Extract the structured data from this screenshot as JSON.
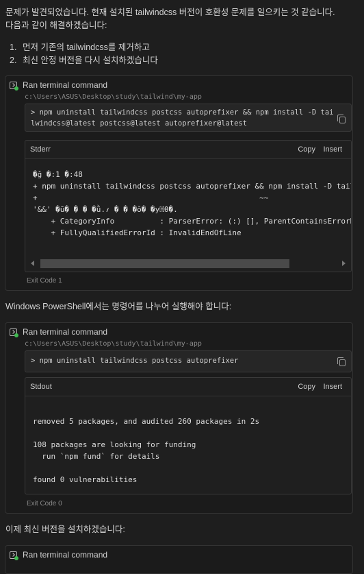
{
  "intro": {
    "line1": "문제가 발견되었습니다. 현재 설치된 tailwindcss 버전이 호환성 문제를 일으키는 것 같습니다.",
    "line2": "다음과 같이 해결하겠습니다:"
  },
  "steps": [
    {
      "num": "1.",
      "text": "먼저 기존의 tailwindcss를 제거하고"
    },
    {
      "num": "2.",
      "text": "최신 안정 버전을 다시 설치하겠습니다"
    }
  ],
  "block1": {
    "title": "Ran terminal command",
    "cwd": "c:\\Users\\ASUS\\Desktop\\study\\tailwind\\my-app",
    "cmd_line1": "> npm uninstall tailwindcss postcss autoprefixer && npm install -D tai",
    "cmd_line2": "lwindcss@latest postcss@latest autoprefixer@latest",
    "output_label": "Stderr",
    "copy_label": "Copy",
    "insert_label": "Insert",
    "output": "�ǧ �:1 �:48\n+ npm uninstall tailwindcss postcss autoprefixer && npm install -D tail ...\n+                                                 ~~\n'&&' �ū� � � �ǜ.؍ � � �ŏ� �yℍθ�.\n    + CategoryInfo          : ParserError: (:) [], ParentContainsErrorReco\n    + FullyQualifiedErrorId : InvalidEndOfLine",
    "exit_code": "Exit Code 1"
  },
  "para2": "Windows PowerShell에서는 명령어를 나누어 실행해야 합니다:",
  "block2": {
    "title": "Ran terminal command",
    "cwd": "c:\\Users\\ASUS\\Desktop\\study\\tailwind\\my-app",
    "cmd_line1": "> npm uninstall tailwindcss postcss autoprefixer",
    "output_label": "Stdout",
    "copy_label": "Copy",
    "insert_label": "Insert",
    "output": "removed 5 packages, and audited 260 packages in 2s\n\n108 packages are looking for funding\n  run `npm fund` for details\n\nfound 0 vulnerabilities",
    "exit_code": "Exit Code 0"
  },
  "para3": "이제 최신 버전을 설치하겠습니다:",
  "block3": {
    "title": "Ran terminal command"
  },
  "colors": {
    "background": "#1e1e1e",
    "card": "#1b1b1b",
    "status_dot": "#3fb950"
  }
}
